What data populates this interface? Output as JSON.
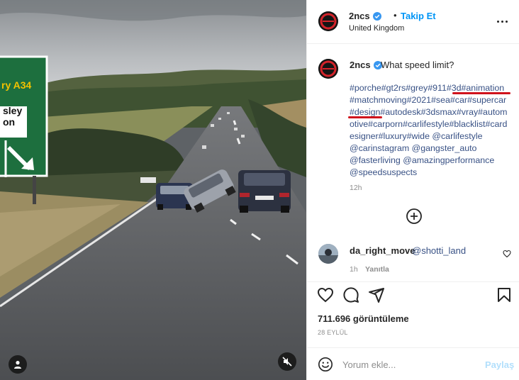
{
  "post": {
    "username": "2ncs",
    "follow_label": "Takip Et",
    "separator": "•",
    "location": "United Kingdom",
    "more_icon": "more-horizontal-icon"
  },
  "media": {
    "road_sign": {
      "road_line": "ry A34",
      "place_line1": "sley",
      "place_line2": "on"
    }
  },
  "caption": {
    "username": "2ncs",
    "text": "What speed limit?",
    "hashtag_lines": [
      "#porche#gt2rs#grey#911#3d#animation",
      "#matchmoving#2021#sea#car#supercar",
      "#design#autodesk#3dsmax#vray#autom",
      "otive#carporn#carlifestyle#blacklist#card",
      "esigner#luxury#wide @carlifestyle",
      "@carinstagram @gangster_auto",
      "@fasterliving @amazingperformance",
      "@speedsuspects"
    ],
    "time": "12h",
    "annotation_color": "#d0131c"
  },
  "comment": {
    "username": "da_right_move",
    "text": "@shotti_land",
    "time": "1h",
    "reply_label": "Yanıtla"
  },
  "stats": {
    "views": "711.696 görüntüleme",
    "date": "28 EYLÜL"
  },
  "input": {
    "placeholder": "Yorum ekle...",
    "post_label": "Paylaş"
  },
  "colors": {
    "link_blue": "#0095f6",
    "hashtag_blue": "#385185",
    "muted": "#8e8e8e",
    "post_disabled": "#b2dffc"
  }
}
